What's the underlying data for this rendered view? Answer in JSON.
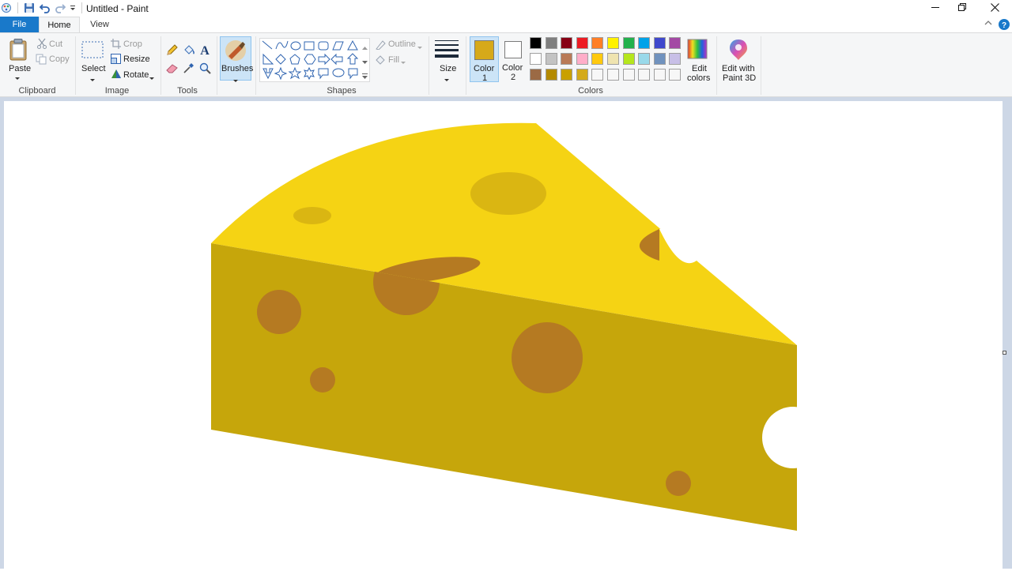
{
  "window": {
    "title": "Untitled - Paint",
    "controls": {
      "minimize": "minimize-icon",
      "restore": "restore-icon",
      "close": "close-icon"
    }
  },
  "quick_access": [
    "paint-app-icon",
    "save-icon",
    "undo-icon",
    "redo-icon",
    "customize-dropdown-icon"
  ],
  "tabs": {
    "file": "File",
    "home": "Home",
    "view": "View"
  },
  "ribbon": {
    "clipboard": {
      "label": "Clipboard",
      "paste": "Paste",
      "cut": "Cut",
      "copy": "Copy"
    },
    "image": {
      "label": "Image",
      "select": "Select",
      "crop": "Crop",
      "resize": "Resize",
      "rotate": "Rotate"
    },
    "tools": {
      "label": "Tools"
    },
    "brushes": {
      "label": "Brushes"
    },
    "shapes": {
      "label": "Shapes",
      "outline": "Outline",
      "fill": "Fill"
    },
    "size": {
      "label": "Size"
    },
    "colors": {
      "label": "Colors",
      "color1": {
        "line1": "Color",
        "line2": "1",
        "value": "#d6a91a"
      },
      "color2": {
        "line1": "Color",
        "line2": "2",
        "value": "#ffffff"
      },
      "edit_colors": {
        "line1": "Edit",
        "line2": "colors"
      },
      "palette": [
        [
          "#000000",
          "#7f7f7f",
          "#880015",
          "#ed1c24",
          "#ff7f27",
          "#fff200",
          "#22b14c",
          "#00a2e8",
          "#3f48cc",
          "#a349a4"
        ],
        [
          "#ffffff",
          "#c3c3c3",
          "#b97a57",
          "#ffaec9",
          "#ffc90e",
          "#efe4b0",
          "#b5e61d",
          "#99d9ea",
          "#7092be",
          "#c8bfe7"
        ],
        [
          "#9b6a45",
          "#b48a00",
          "#c9a000",
          "#d4aa1a",
          "#f7f7f7",
          "#f7f7f7",
          "#f7f7f7",
          "#f7f7f7",
          "#f7f7f7",
          "#f7f7f7"
        ]
      ]
    },
    "paint3d": {
      "line1": "Edit with",
      "line2": "Paint 3D"
    }
  },
  "canvas": {
    "drawing": "cheese-wedge",
    "colors": {
      "top": "#f5d314",
      "side": "#c6a60b",
      "hole_top": "#dab612",
      "hole_side": "#b57a22"
    }
  }
}
